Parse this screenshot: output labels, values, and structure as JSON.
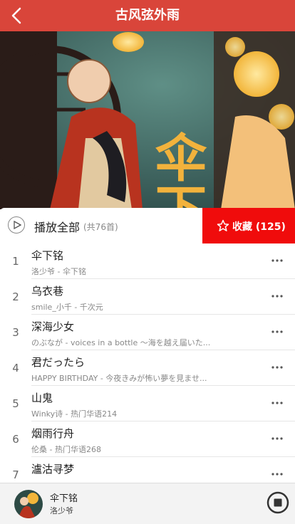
{
  "header": {
    "title": "古风弦外雨"
  },
  "hero": {
    "calligraphy": "伞下铭"
  },
  "play_bar": {
    "label": "播放全部",
    "count": "(共76首)"
  },
  "collect": {
    "label": "收藏 (125)"
  },
  "songs": [
    {
      "index": "1",
      "title": "伞下铭",
      "subtitle": "洛少爷 - 伞下铭"
    },
    {
      "index": "2",
      "title": "乌衣巷",
      "subtitle": "smile_小千 - 千次元"
    },
    {
      "index": "3",
      "title": "深海少女",
      "subtitle": "のぶなが - voices in a bottle ～海を越え届いた..."
    },
    {
      "index": "4",
      "title": "君だったら",
      "subtitle": "HAPPY BIRTHDAY - 今夜きみが怖い夢を見ませ..."
    },
    {
      "index": "5",
      "title": "山鬼",
      "subtitle": "Winky诗 - 热门华语214"
    },
    {
      "index": "6",
      "title": "烟雨行舟",
      "subtitle": "伦桑 - 热门华语268"
    },
    {
      "index": "7",
      "title": "瀘沽寻梦",
      "subtitle": ""
    }
  ],
  "player": {
    "title": "伞下铭",
    "artist": "洛少爷"
  },
  "colors": {
    "header": "#d9453a",
    "collect": "#f00c0c"
  }
}
